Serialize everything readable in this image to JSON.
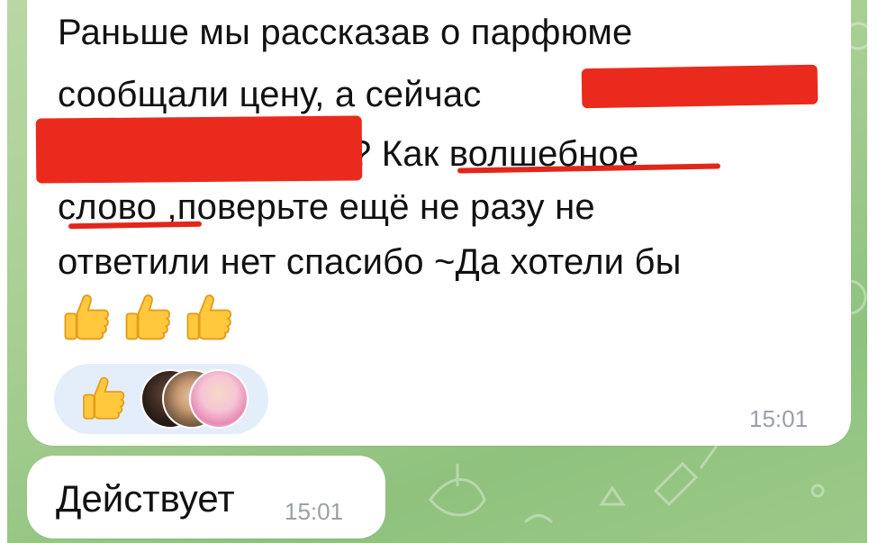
{
  "message": {
    "lines": [
      "Раньше мы рассказав о парфюме",
      "сообщали цену, а сейчас",
      "? Как волшебное",
      "слово ,поверьте ещё не разу не",
      "ответили нет спасибо ~Да хотели бы"
    ],
    "emoji": [
      "👍",
      "👍",
      "👍"
    ],
    "time": "15:01"
  },
  "reaction": {
    "emoji": "👍",
    "avatars": [
      "avatar-1",
      "avatar-2",
      "avatar-3"
    ]
  },
  "reply": {
    "text": "Действует",
    "time": "15:01"
  },
  "colors": {
    "chat_background": "#a7cf92",
    "bubble": "#ffffff",
    "redaction": "#ea2a1c",
    "reaction_pill": "#e3eefa",
    "timestamp": "#9aa0a6"
  }
}
